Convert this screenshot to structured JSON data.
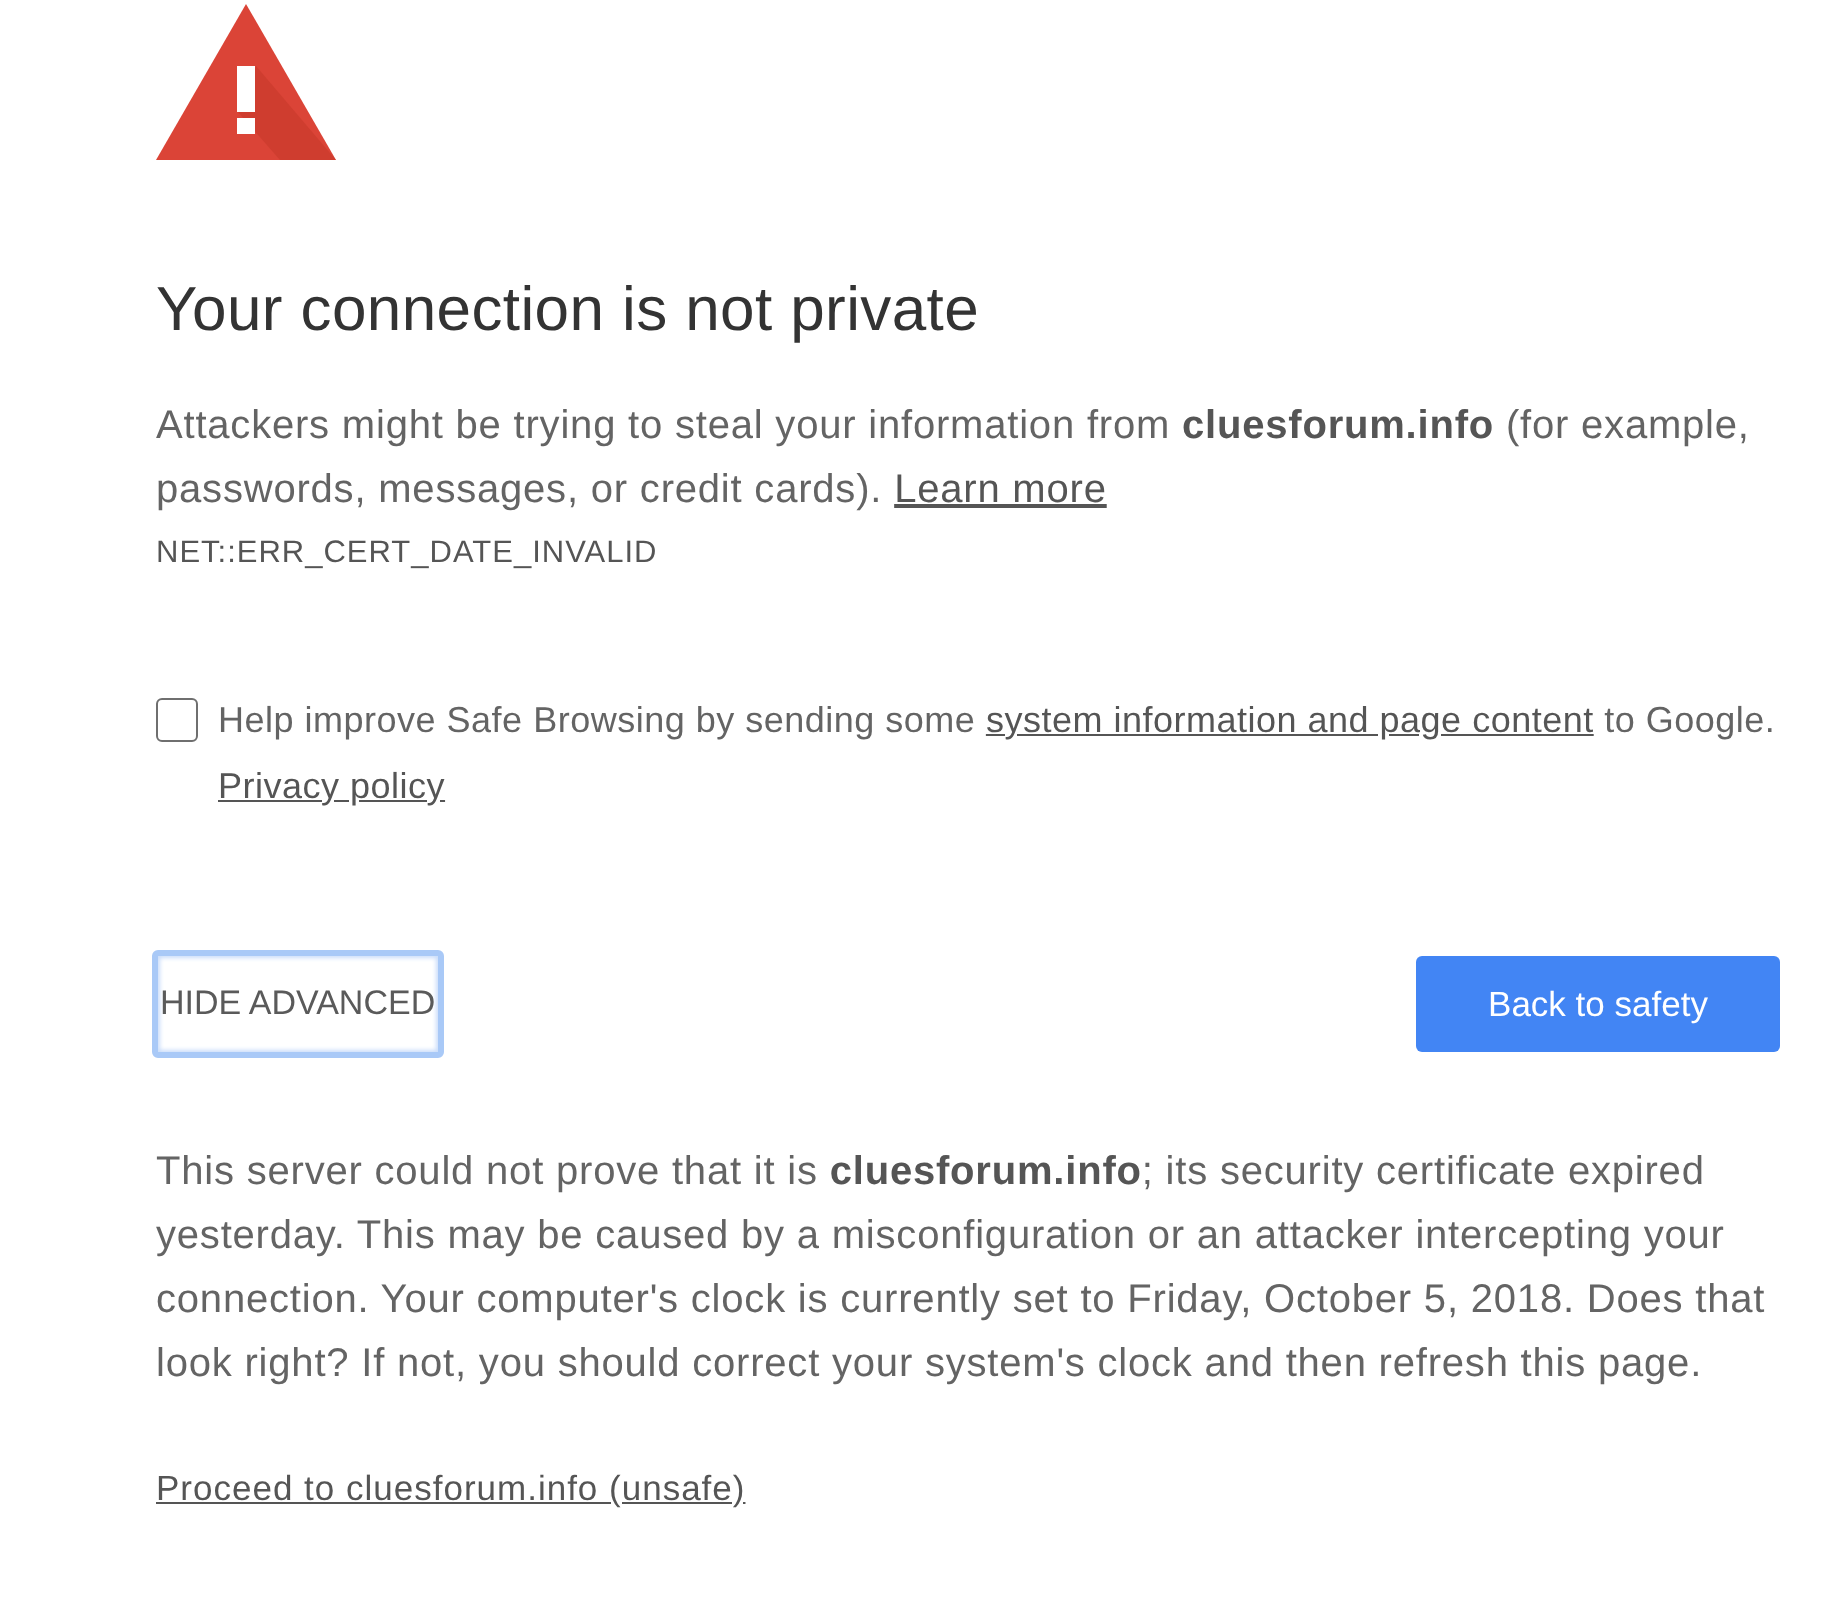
{
  "heading": "Your connection is not private",
  "intro": {
    "text": "Attackers might be trying to steal your information from **cluesforum.info** (for example, passwords, messages, or credit cards).",
    "link": "Learn more"
  },
  "error_code": "NET::ERR_CERT_DATE_INVALID",
  "opt_in": {
    "checked": false,
    "text_before": "Help improve Safe Browsing by sending some",
    "link": "system information and page content",
    "text_after": "to Google.",
    "privacy_link": "Privacy policy"
  },
  "buttons": [
    {
      "kind": "secondary",
      "label": "HIDE ADVANCED",
      "focused": true
    },
    {
      "kind": "primary",
      "label": "Back to safety",
      "focused": false
    }
  ],
  "details": "This server could not prove that it is **cluesforum.info**; its security certificate expired yesterday. This may be caused by a misconfiguration or an attacker intercepting your connection. Your computer's clock is currently set to Friday, October 5, 2018. Does that look right? If not, you should correct your system's clock and then refresh this page.",
  "proceed_link": "Proceed to cluesforum.info (unsafe)"
}
